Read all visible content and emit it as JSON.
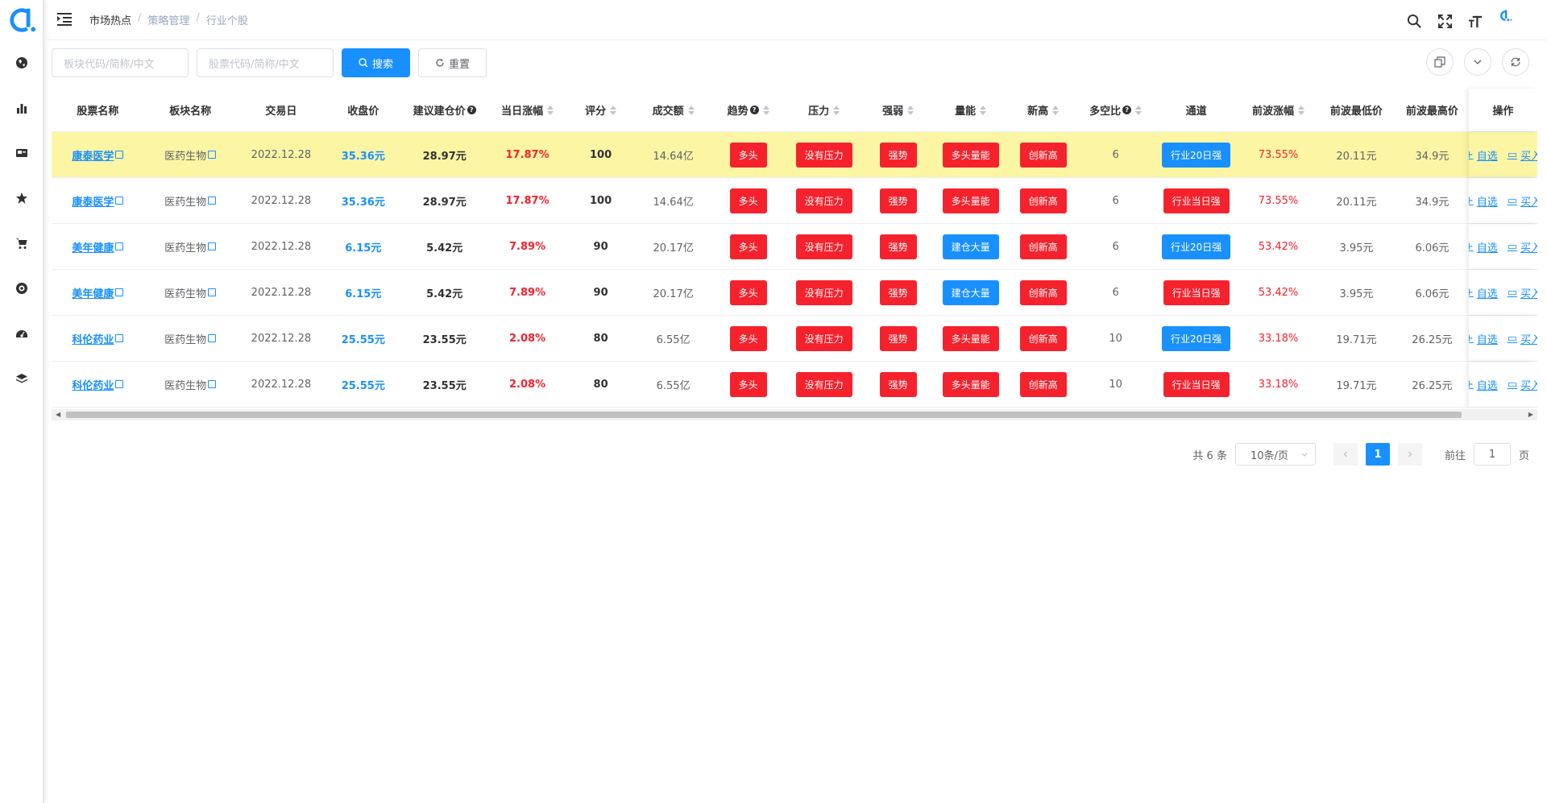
{
  "header": {
    "breadcrumb": [
      "市场热点",
      "策略管理",
      "行业个股"
    ]
  },
  "search": {
    "sector_placeholder": "板块代码/简称/中文",
    "stock_placeholder": "股票代码/简称/中文",
    "search_label": "搜索",
    "reset_label": "重置"
  },
  "table": {
    "columns": [
      "股票名称",
      "板块名称",
      "交易日",
      "收盘价",
      "建议建仓价",
      "当日涨幅",
      "评分",
      "成交额",
      "趋势",
      "压力",
      "强弱",
      "量能",
      "新高",
      "多空比",
      "通道",
      "前波涨幅",
      "前波最低价",
      "前波最高价",
      "操作"
    ],
    "rows": [
      {
        "name": "康泰医学",
        "sector": "医药生物",
        "date": "2022.12.28",
        "close": "35.36元",
        "suggest": "28.97元",
        "change": "17.87%",
        "score": "100",
        "amount": "14.64亿",
        "trend": "多头",
        "pressure": "没有压力",
        "strength": "强势",
        "volume": "多头量能",
        "volume_color": "red",
        "high": "创新高",
        "ratio": "6",
        "channel": "行业20日强",
        "channel_color": "blue",
        "prev_change": "73.55%",
        "prev_low": "20.11元",
        "prev_high": "34.9元",
        "highlight": true
      },
      {
        "name": "康泰医学",
        "sector": "医药生物",
        "date": "2022.12.28",
        "close": "35.36元",
        "suggest": "28.97元",
        "change": "17.87%",
        "score": "100",
        "amount": "14.64亿",
        "trend": "多头",
        "pressure": "没有压力",
        "strength": "强势",
        "volume": "多头量能",
        "volume_color": "red",
        "high": "创新高",
        "ratio": "6",
        "channel": "行业当日强",
        "channel_color": "red",
        "prev_change": "73.55%",
        "prev_low": "20.11元",
        "prev_high": "34.9元",
        "highlight": false
      },
      {
        "name": "美年健康",
        "sector": "医药生物",
        "date": "2022.12.28",
        "close": "6.15元",
        "suggest": "5.42元",
        "change": "7.89%",
        "score": "90",
        "amount": "20.17亿",
        "trend": "多头",
        "pressure": "没有压力",
        "strength": "强势",
        "volume": "建仓大量",
        "volume_color": "blue",
        "high": "创新高",
        "ratio": "6",
        "channel": "行业20日强",
        "channel_color": "blue",
        "prev_change": "53.42%",
        "prev_low": "3.95元",
        "prev_high": "6.06元",
        "highlight": false
      },
      {
        "name": "美年健康",
        "sector": "医药生物",
        "date": "2022.12.28",
        "close": "6.15元",
        "suggest": "5.42元",
        "change": "7.89%",
        "score": "90",
        "amount": "20.17亿",
        "trend": "多头",
        "pressure": "没有压力",
        "strength": "强势",
        "volume": "建仓大量",
        "volume_color": "blue",
        "high": "创新高",
        "ratio": "6",
        "channel": "行业当日强",
        "channel_color": "red",
        "prev_change": "53.42%",
        "prev_low": "3.95元",
        "prev_high": "6.06元",
        "highlight": false
      },
      {
        "name": "科伦药业",
        "sector": "医药生物",
        "date": "2022.12.28",
        "close": "25.55元",
        "suggest": "23.55元",
        "change": "2.08%",
        "score": "80",
        "amount": "6.55亿",
        "trend": "多头",
        "pressure": "没有压力",
        "strength": "强势",
        "volume": "多头量能",
        "volume_color": "red",
        "high": "创新高",
        "ratio": "10",
        "channel": "行业20日强",
        "channel_color": "blue",
        "prev_change": "33.18%",
        "prev_low": "19.71元",
        "prev_high": "26.25元",
        "highlight": false
      },
      {
        "name": "科伦药业",
        "sector": "医药生物",
        "date": "2022.12.28",
        "close": "25.55元",
        "suggest": "23.55元",
        "change": "2.08%",
        "score": "80",
        "amount": "6.55亿",
        "trend": "多头",
        "pressure": "没有压力",
        "strength": "强势",
        "volume": "多头量能",
        "volume_color": "red",
        "high": "创新高",
        "ratio": "10",
        "channel": "行业当日强",
        "channel_color": "red",
        "prev_change": "33.18%",
        "prev_low": "19.71元",
        "prev_high": "26.25元",
        "highlight": false
      }
    ],
    "op_watch": "自选",
    "op_buy": "买入"
  },
  "pagination": {
    "total": "共 6 条",
    "page_size": "10条/页",
    "current": "1",
    "goto_label": "前往",
    "goto_value": "1",
    "page_suffix": "页"
  },
  "colors": {
    "primary": "#1890ff",
    "danger": "#f5222d",
    "highlight": "#fcf6a4"
  }
}
